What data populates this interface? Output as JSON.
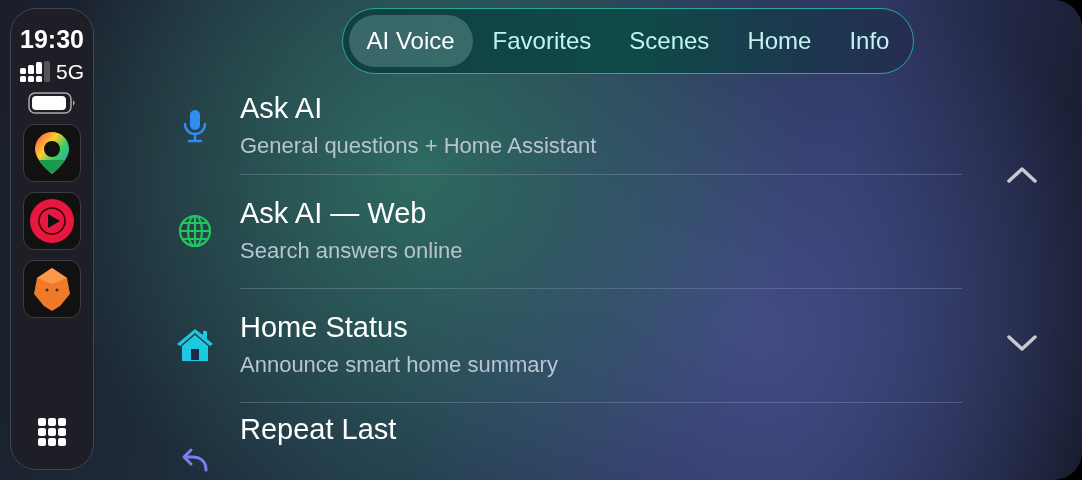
{
  "status": {
    "time": "19:30",
    "network": "5G"
  },
  "dock": [
    {
      "kind": "maps"
    },
    {
      "kind": "music"
    },
    {
      "kind": "fox"
    }
  ],
  "tabs": [
    {
      "label": "AI Voice",
      "selected": true
    },
    {
      "label": "Favorites",
      "selected": false
    },
    {
      "label": "Scenes",
      "selected": false
    },
    {
      "label": "Home",
      "selected": false
    },
    {
      "label": "Info",
      "selected": false
    }
  ],
  "items": [
    {
      "kind": "mic",
      "color": "#2f8cf0",
      "title": "Ask AI",
      "subtitle": "General questions + Home Assistant"
    },
    {
      "kind": "globe",
      "color": "#22c55e",
      "title": "Ask AI — Web",
      "subtitle": "Search answers online"
    },
    {
      "kind": "home",
      "color": "#1ec8e0",
      "title": "Home Status",
      "subtitle": "Announce smart home summary"
    },
    {
      "kind": "repeat",
      "color": "#7a7ff0",
      "title": "Repeat Last"
    }
  ]
}
